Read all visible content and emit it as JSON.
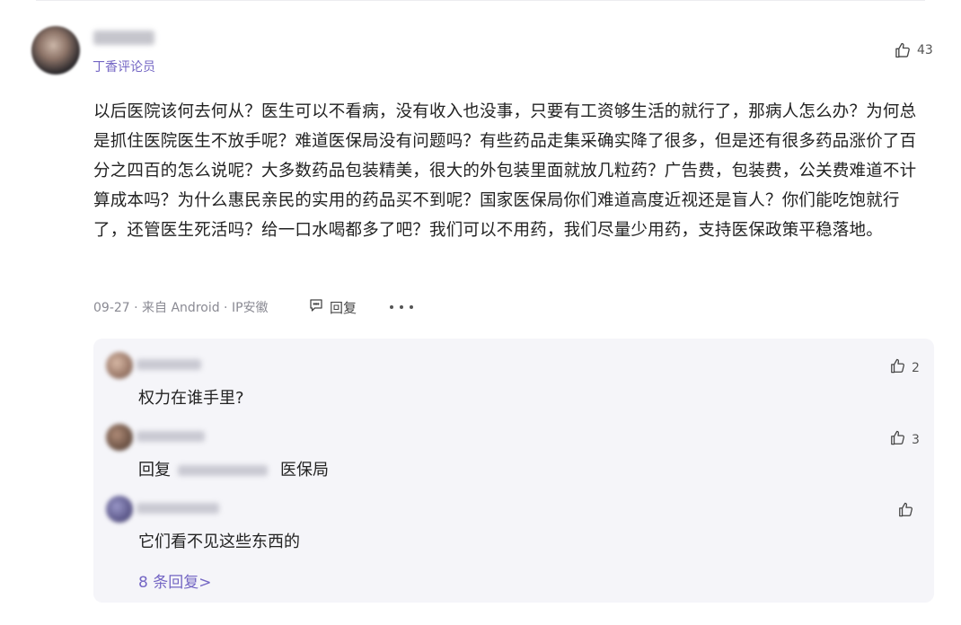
{
  "comment": {
    "user_role": "丁香评论员",
    "like_count": "43",
    "body": "以后医院该何去何从？医生可以不看病，没有收入也没事，只要有工资够生活的就行了，那病人怎么办？为何总是抓住医院医生不放手呢？难道医保局没有问题吗？有些药品走集采确实降了很多，但是还有很多药品涨价了百分之四百的怎么说呢？大多数药品包装精美，很大的外包装里面就放几粒药？广告费，包装费，公关费难道不计算成本吗？为什么惠民亲民的实用的药品买不到呢？国家医保局你们难道高度近视还是盲人？你们能吃饱就行了，还管医生死活吗？给一口水喝都多了吧？我们可以不用药，我们尽量少用药，支持医保政策平稳落地。",
    "meta": "09-27 · 来自 Android · IP安徽",
    "reply_label": "回复"
  },
  "replies": [
    {
      "text": "权力在谁手里?",
      "like_count": "2"
    },
    {
      "prefix": "回复",
      "text": "医保局",
      "like_count": "3"
    },
    {
      "text": "它们看不见这些东西的",
      "like_count": ""
    }
  ],
  "more_replies": "8 条回复>",
  "icons": {
    "like": "thumbs-up-icon",
    "reply": "comment-bubble-icon",
    "more": "more-dots-icon"
  },
  "colors": {
    "accent": "#7466c4",
    "reply_bg": "#f5f5f9",
    "text": "#222222",
    "meta": "#8a8a93"
  }
}
